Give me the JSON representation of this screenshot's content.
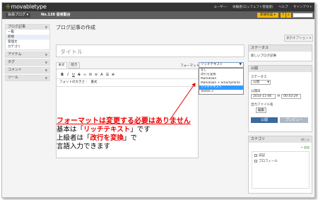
{
  "header": {
    "logo": "movabletype",
    "user_links": [
      "ユーザー:",
      "体験者(ロッフェフト管理者)",
      "ヘルプ",
      "サインアウト"
    ],
    "blog_menu": "会員ブログ ▾",
    "blog_id": "No.138 昼夜勤台",
    "new_button": "新規作成 ▾",
    "small_button": "?"
  },
  "sidebar": {
    "sections": [
      {
        "title": "ブログ記事",
        "items": [
          "一覧",
          "新規",
          "管理文",
          "カテゴリ"
        ]
      },
      {
        "title": "アイテム",
        "items": []
      },
      {
        "title": "タグ",
        "items": []
      },
      {
        "title": "コメント",
        "items": []
      },
      {
        "title": "ツール",
        "items": []
      }
    ]
  },
  "main": {
    "page_title": "ブログ記事の作成",
    "display_options": "表示オプション ▾",
    "title_placeholder": "タイトル",
    "tabs": [
      "本文",
      "続き"
    ],
    "format_label": "フォーマット",
    "format_selected": "リッチテキスト",
    "format_options": [
      "なし",
      "改行を変換",
      "Markdown",
      "Markdown + SmartyPants",
      "リッチテキスト",
      "Textile 2"
    ],
    "format_selected_index": 4,
    "toolbar": [
      "B",
      "I",
      "U",
      "S",
      "∞",
      "✉",
      "≡",
      "A",
      "☰",
      "≣"
    ],
    "toolbar2": [
      "フォントの大きさ :",
      "書式"
    ]
  },
  "annotation": {
    "red_line": "フォーマットは変更する必要はありません",
    "line2_pre": "基本は「",
    "line2_bold": "リッチテキスト",
    "line2_post": "」です",
    "line3_pre": "上級者は「",
    "line3_bold": "改行を変換",
    "line3_post": "」で",
    "line4": "言語入力できます"
  },
  "status_panel": {
    "title": "ステータス",
    "value": "新しいブログ記事"
  },
  "publish_panel": {
    "title": "公開",
    "status_label": "ステータス",
    "status_value": "公開",
    "date_label": "公開日",
    "date_value": "2014-11-06",
    "time_value": "00:43:29",
    "file_label": "出力ファイル名",
    "edit_button": "編集",
    "publish_button": "公開",
    "preview_button": "プレビュー"
  },
  "category_panel": {
    "title": "カテゴリ",
    "toggle": "閉じる",
    "add": "追加",
    "items": [
      "日記",
      "プロフィール"
    ]
  },
  "colors": {
    "accent": "#f5b800",
    "topbar": "#333333",
    "annotation": "#ee0000",
    "publish": "#3b6a9d"
  }
}
